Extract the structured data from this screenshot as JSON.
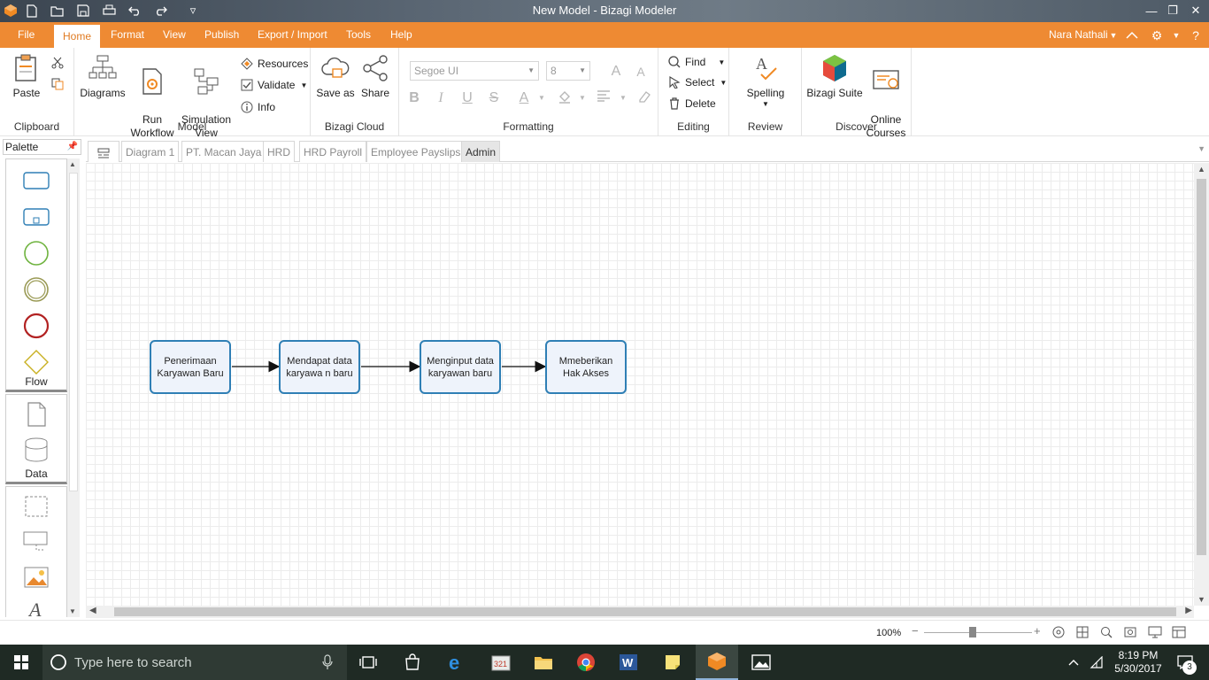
{
  "window": {
    "title": "New Model - Bizagi Modeler"
  },
  "menu": {
    "items": [
      "File",
      "Home",
      "Format",
      "View",
      "Publish",
      "Export / Import",
      "Tools",
      "Help"
    ],
    "active": "Home",
    "user": "Nara Nathali"
  },
  "ribbon": {
    "clipboard": {
      "label": "Clipboard",
      "paste": "Paste"
    },
    "model": {
      "label": "Model",
      "diagrams": "Diagrams",
      "run_workflow": "Run\nWorkflow",
      "simulation_view": "Simulation\nView",
      "resources": "Resources",
      "validate": "Validate",
      "info": "Info"
    },
    "cloud": {
      "label": "Bizagi Cloud",
      "save_as": "Save as",
      "share": "Share"
    },
    "formatting": {
      "label": "Formatting",
      "font": "Segoe UI",
      "size": "8"
    },
    "editing": {
      "label": "Editing",
      "find": "Find",
      "select": "Select",
      "delete": "Delete"
    },
    "review": {
      "label": "Review",
      "spelling": "Spelling"
    },
    "discover": {
      "label": "Discover",
      "suite": "Bizagi Suite",
      "courses": "Online\nCourses"
    }
  },
  "palette": {
    "title": "Palette",
    "sections": [
      {
        "label": "Flow"
      },
      {
        "label": "Data"
      }
    ]
  },
  "tabs": [
    "Diagram 1",
    "PT. Macan Jaya",
    "HRD",
    "HRD Payroll",
    "Employee Payslips",
    "Admin"
  ],
  "active_tab": "Admin",
  "diagram": {
    "tasks": [
      {
        "id": "t1",
        "text": "Penerimaan Karyawan Baru"
      },
      {
        "id": "t2",
        "text": "Mendapat data karyawa n baru"
      },
      {
        "id": "t3",
        "text": "Menginput data karyawan baru"
      },
      {
        "id": "t4",
        "text": "Mmeberikan Hak Akses"
      }
    ]
  },
  "status": {
    "zoom": "100%",
    "zoom_level": 0.45
  },
  "taskbar": {
    "search_placeholder": "Type here to search",
    "time": "8:19 PM",
    "date": "5/30/2017",
    "notifications": "3"
  },
  "colors": {
    "accent": "#ee8a33",
    "task_border": "#2f7fb5",
    "task_fill": "#eef3fb"
  }
}
